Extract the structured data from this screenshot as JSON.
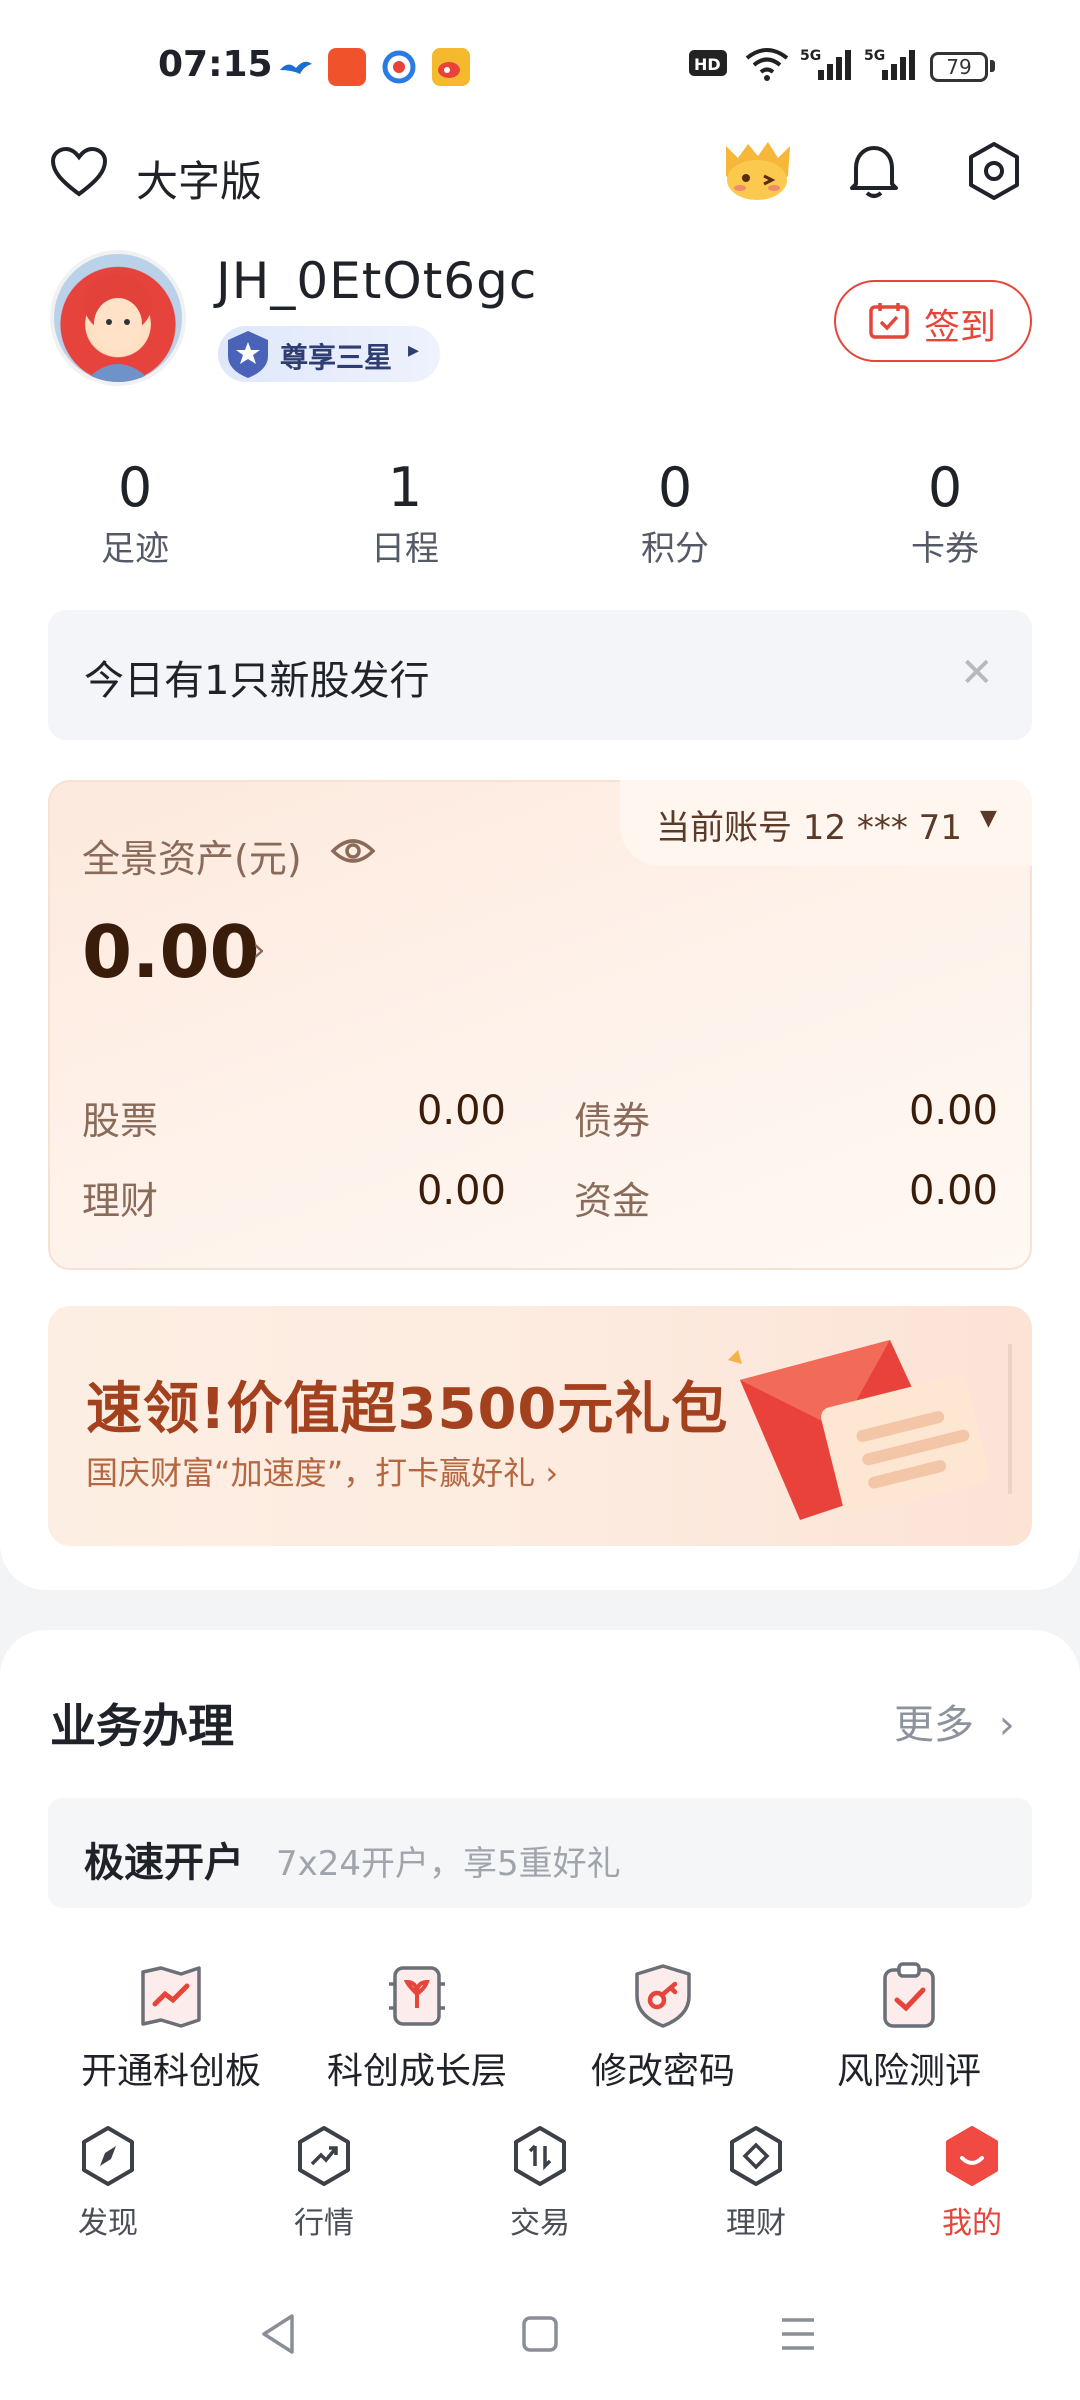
{
  "status_bar": {
    "time": "07:15",
    "battery": "79",
    "icons": [
      "bird-app-icon",
      "red-app-icon",
      "camera-app-icon",
      "weibo-icon",
      "hd-icon",
      "wifi-icon",
      "5g-signal-icon",
      "5g-signal-icon"
    ]
  },
  "header": {
    "big_font_label": "大字版",
    "username": "JH_0EtOt6gc",
    "vip_level": "尊享三星",
    "signin_label": "签到"
  },
  "stats": [
    {
      "value": "0",
      "label": "足迹"
    },
    {
      "value": "1",
      "label": "日程"
    },
    {
      "value": "0",
      "label": "积分"
    },
    {
      "value": "0",
      "label": "卡券"
    }
  ],
  "notice": {
    "text": "今日有1只新股发行",
    "close": "✕"
  },
  "assets": {
    "account_label": "当前账号 12 *** 71",
    "title": "全景资产(元)",
    "total": "0.00",
    "items": [
      {
        "label": "股票",
        "value": "0.00"
      },
      {
        "label": "债券",
        "value": "0.00"
      },
      {
        "label": "理财",
        "value": "0.00"
      },
      {
        "label": "资金",
        "value": "0.00"
      }
    ]
  },
  "banner": {
    "title": "速领!价值超3500元礼包",
    "subtitle": "国庆财富“加速度”，打卡赢好礼 ›"
  },
  "business": {
    "title": "业务办理",
    "more": "更多",
    "quick_open_title": "极速开户",
    "quick_open_sub": "7x24开户，享5重好礼",
    "services": [
      {
        "label": "开通科创板",
        "icon": "star-board-icon"
      },
      {
        "label": "科创成长层",
        "icon": "growth-tier-icon"
      },
      {
        "label": "修改密码",
        "icon": "key-shield-icon"
      },
      {
        "label": "风险测评",
        "icon": "clipboard-check-icon"
      }
    ]
  },
  "nav": {
    "items": [
      {
        "label": "发现",
        "icon": "compass-icon"
      },
      {
        "label": "行情",
        "icon": "trend-icon"
      },
      {
        "label": "交易",
        "icon": "trade-icon"
      },
      {
        "label": "理财",
        "icon": "wealth-icon"
      },
      {
        "label": "我的",
        "icon": "profile-icon"
      }
    ],
    "active_index": 4
  },
  "colors": {
    "accent": "#e5453b",
    "asset_text": "#3a1c0a",
    "banner_title": "#a3401e"
  }
}
